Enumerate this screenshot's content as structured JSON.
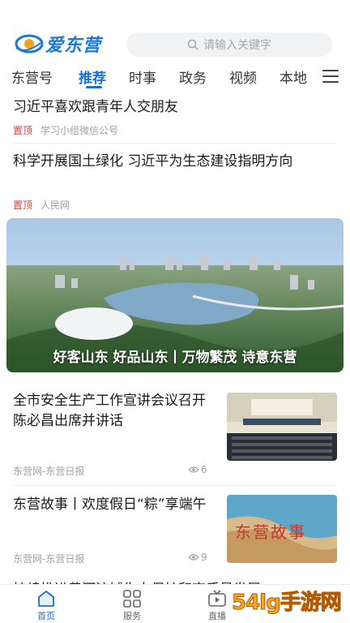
{
  "header": {
    "logo_text": "爱东营",
    "search_placeholder": "请输入关键字"
  },
  "tabs": [
    {
      "label": "东营号"
    },
    {
      "label": "推荐"
    },
    {
      "label": "时事"
    },
    {
      "label": "政务"
    },
    {
      "label": "视频"
    },
    {
      "label": "本地"
    }
  ],
  "feed": {
    "item1": {
      "title": "习近平喜欢跟青年人交朋友",
      "tag": "置顶",
      "source": "学习小组微信公号"
    },
    "item2": {
      "title": "科学开展国土绿化  习近平为生态建设指明方向",
      "tag": "置顶",
      "source": "人民网"
    },
    "hero": {
      "caption": "好客山东  好品山东丨万物繁茂  诗意东营"
    },
    "news1": {
      "title": "全市安全生产工作宣讲会议召开  陈必昌出席并讲话",
      "source": "东营网-东营日报",
      "views": "6"
    },
    "news2": {
      "title": "东营故事丨欢度假日“粽”享端午",
      "source": "东营网-东营日报",
      "views": "9",
      "thumb_text": "东营故事"
    },
    "partial_title": "持续推进黄河流域生态保护和高质量发展"
  },
  "tabbar": [
    {
      "label": "首页"
    },
    {
      "label": "服务"
    },
    {
      "label": "直播"
    }
  ],
  "watermark": {
    "text": "54lg手游网"
  },
  "colors": {
    "accent": "#1c6fd3",
    "top_tag": "#d9403a"
  }
}
